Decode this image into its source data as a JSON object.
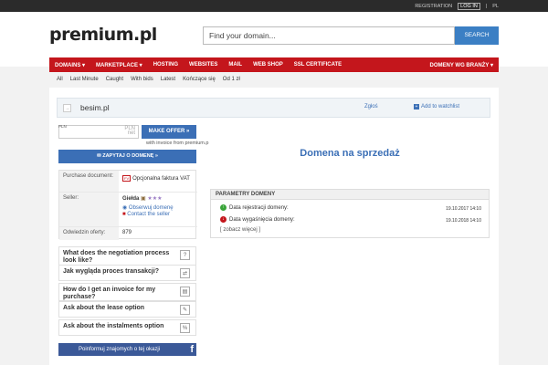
{
  "topbar": {
    "registration": "REGISTRATION",
    "login": "LOG IN",
    "separator": "|",
    "lang": "PL"
  },
  "header": {
    "logo": "premium.pl",
    "search_placeholder": "Find your domain...",
    "search_button": "SEARCH"
  },
  "nav": {
    "items": [
      "DOMAINS ▾",
      "MARKETPLACE ▾",
      "HOSTING",
      "WEBSITES",
      "MAIL",
      "WEB SHOP",
      "SSL CERTIFICATE"
    ],
    "right": "DOMENY WG BRANŻY ▾"
  },
  "filters": [
    "All",
    "Last Minute",
    "Caught",
    "With bids",
    "Latest",
    "Kończące się",
    "Od 1 zł"
  ],
  "domain": {
    "name": "besim.pl",
    "report": "Zgłoś",
    "watchlist": "Add to watchlist"
  },
  "offer": {
    "pln_label": "PLN",
    "currency": "PLN",
    "net": "net",
    "make_offer": "MAKE OFFER »",
    "invoice_note": "with invoice from premium.p",
    "ask_owner": "ZAPYTAJ O DOMENĘ »"
  },
  "info": {
    "purchase_label": "Purchase document:",
    "purchase_value": "Opcjonalna faktura VAT",
    "seller_label": "Seller:",
    "seller_name": "Giełda",
    "observe": "Obserwuj domenę",
    "contact": "Contact the seller",
    "views_label": "Odwiedzin oferty:",
    "views_value": "879"
  },
  "faq": [
    {
      "q": "What does the negotiation process look like?",
      "icon": "?"
    },
    {
      "q": "Jak wygląda proces transakcji?",
      "icon": "⇄"
    },
    {
      "q": "How do I get an invoice for my purchase?",
      "icon": "▤"
    },
    {
      "q": "Ask about the lease option",
      "icon": "✎"
    },
    {
      "q": "Ask about the instalments option",
      "icon": "%"
    }
  ],
  "facebook": {
    "text": "Poinformuj znajomych o tej okazji",
    "icon": "f"
  },
  "sale_title": "Domena na sprzedaż",
  "params": {
    "header": "PARAMETRY DOMENY",
    "reg_label": "Data rejestracji domeny:",
    "reg_date": "19.10.2017 14:10",
    "exp_label": "Data wygaśnięcia domeny:",
    "exp_date": "19.10.2018 14:10",
    "more": "[ zobacz więcej ]"
  },
  "colors": {
    "accent_red": "#c4161c",
    "accent_blue": "#3b6fb6",
    "facebook": "#3b5998"
  }
}
